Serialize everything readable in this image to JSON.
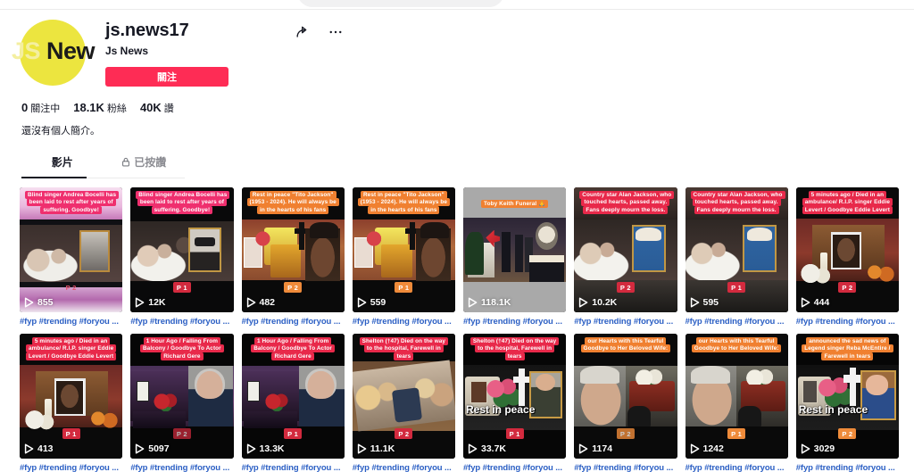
{
  "search": {
    "placeholder": ""
  },
  "profile": {
    "avatar_text_dim": "JS",
    "avatar_text_bold": "New",
    "username": "js.news17",
    "nickname": "Js News",
    "follow_label": "關注",
    "share_icon": "share-icon",
    "more_icon": "more-options-icon",
    "stats": [
      {
        "value": "0",
        "label": "關注中"
      },
      {
        "value": "18.1K",
        "label": "粉絲"
      },
      {
        "value": "40K",
        "label": "讚"
      }
    ],
    "bio": "還沒有個人簡介。"
  },
  "tabs": [
    {
      "label": "影片",
      "active": true,
      "icon": null
    },
    {
      "label": "已按讚",
      "active": false,
      "icon": "lock-icon"
    }
  ],
  "videos": [
    {
      "caption": "Blind singer Andrea Bocelli has been laid to rest after years of suffering. Goodbye!",
      "caption_style": "pink",
      "badge": "P 2",
      "badge_style": "pinkish",
      "plays": "855",
      "tags": "#fyp #trending #foryou ...",
      "scene": "bocelli-blur"
    },
    {
      "caption": "Blind singer Andrea Bocelli has been laid to rest after years of suffering. Goodbye!",
      "caption_style": "pink",
      "badge": "P 1",
      "badge_style": "red",
      "plays": "12K",
      "tags": "#fyp #trending #foryou ...",
      "scene": "bocelli"
    },
    {
      "caption": "Rest in peace \"Tito Jackson\" (1953 - 2024). He will always be in the hearts of his fans",
      "caption_style": "orange",
      "badge": "P 2",
      "badge_style": "orange",
      "plays": "482",
      "tags": "#fyp #trending #foryou ...",
      "scene": "jackson"
    },
    {
      "caption": "Rest in peace \"Tito Jackson\" (1953 - 2024). He will always be in the hearts of his fans",
      "caption_style": "orange",
      "badge": "P 1",
      "badge_style": "orange",
      "plays": "559",
      "tags": "#fyp #trending #foryou ...",
      "scene": "jackson"
    },
    {
      "caption": "Toby Keith Funeral 🙏",
      "caption_style": "orange-plain",
      "badge": null,
      "badge_style": null,
      "plays": "118.1K",
      "tags": "#fyp #trending #foryou ...",
      "scene": "tobykeith"
    },
    {
      "caption": "Country star Alan Jackson, who touched hearts, passed away. Fans deeply mourn the loss.",
      "caption_style": "red",
      "badge": "P 2",
      "badge_style": "red",
      "plays": "10.2K",
      "tags": "#fyp #trending #foryou ...",
      "scene": "alanjackson"
    },
    {
      "caption": "Country star Alan Jackson, who touched hearts, passed away. Fans deeply mourn the loss.",
      "caption_style": "red",
      "badge": "P 1",
      "badge_style": "red",
      "plays": "595",
      "tags": "#fyp #trending #foryou ...",
      "scene": "alanjackson"
    },
    {
      "caption": "5 minutes ago / Died in an ambulance/ R.I.P. singer Eddie Levert / Goodbye Eddie Levert",
      "caption_style": "red",
      "badge": "P 2",
      "badge_style": "red",
      "plays": "444",
      "tags": "#fyp #trending #foryou ...",
      "scene": "levert"
    },
    {
      "caption": "5 minutes ago / Died in an ambulance/ R.I.P. singer Eddie Levert / Goodbye Eddie Levert",
      "caption_style": "red",
      "badge": "P 1",
      "badge_style": "red",
      "plays": "413",
      "tags": "#fyp #trending #foryou ...",
      "scene": "levert"
    },
    {
      "caption": "1 Hour Ago / Falling From Balcony / Goodbye To Actor Richard Gere",
      "caption_style": "red",
      "badge": "P 2",
      "badge_style": "ghost",
      "plays": "5097",
      "tags": "#fyp #trending #foryou ...",
      "scene": "gere"
    },
    {
      "caption": "1 Hour Ago / Falling From Balcony / Goodbye To Actor Richard Gere",
      "caption_style": "red",
      "badge": "P 1",
      "badge_style": "red",
      "plays": "13.3K",
      "tags": "#fyp #trending #foryou ...",
      "scene": "gere"
    },
    {
      "caption": "Shelton (†47) Died on the way to the hospital, Farewell in tears",
      "caption_style": "red",
      "badge": "P 2",
      "badge_style": "red",
      "plays": "11.1K",
      "tags": "#fyp #trending #foryou ...",
      "scene": "shelton-crowd"
    },
    {
      "caption": "Shelton (†47) Died on the way to the hospital, Farewell in tears",
      "caption_style": "red",
      "badge": "P 1",
      "badge_style": "red",
      "plays": "33.7K",
      "tags": "#fyp #trending #foryou ...",
      "scene": "shelton-rip",
      "overlay_text": "Rest in peace"
    },
    {
      "caption": "our Hearts with this Tearful Goodbye to Her Beloved Wife:",
      "caption_style": "orange",
      "badge": "P 2",
      "badge_style": "ghost2",
      "plays": "1174",
      "tags": "#fyp #trending #foryou ...",
      "scene": "tomjones"
    },
    {
      "caption": "our Hearts with this Tearful Goodbye to Her Beloved Wife:",
      "caption_style": "orange",
      "badge": "P 1",
      "badge_style": "orange",
      "plays": "1242",
      "tags": "#fyp #trending #foryou ...",
      "scene": "tomjones"
    },
    {
      "caption": "announced the sad news of Legend singer Reba McEntire / Farewell in tears",
      "caption_style": "orange",
      "badge": "P 2",
      "badge_style": "orange",
      "plays": "3029",
      "tags": "#fyp #trending #foryou ...",
      "scene": "reba",
      "overlay_text": "Rest in peace"
    }
  ],
  "colors": {
    "accent": "#fe2c55",
    "avatar_bg": "#ece53f",
    "tag_blue": "#2b5fc4",
    "caption_red": "#e8294a",
    "caption_orange": "#f08030"
  }
}
